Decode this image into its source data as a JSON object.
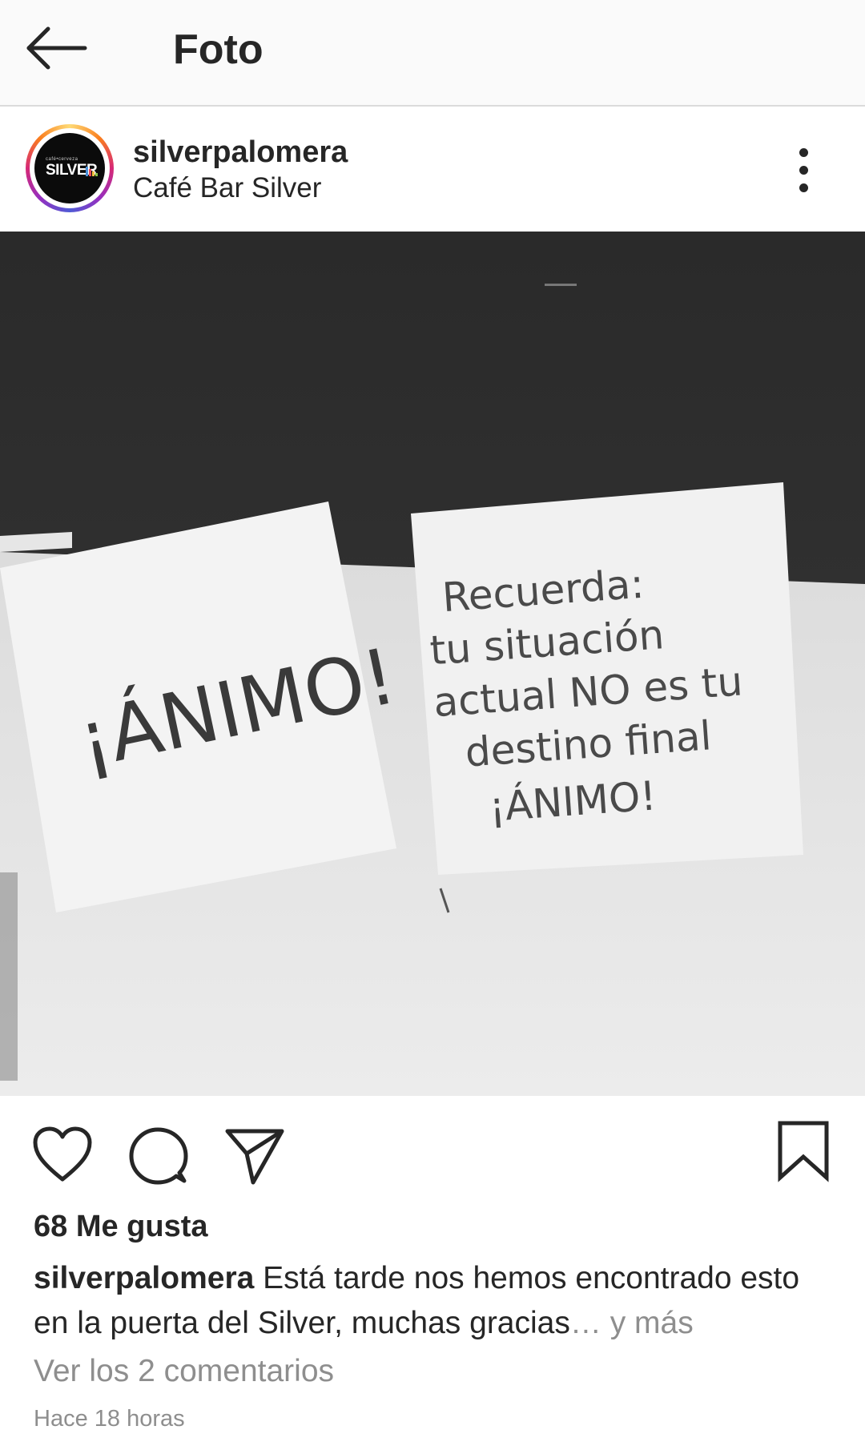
{
  "topbar": {
    "title": "Foto"
  },
  "post": {
    "username": "silverpalomera",
    "location": "Café Bar Silver",
    "avatar_label": "SILVER",
    "avatar_small_label": "café•cerveza",
    "photo": {
      "left_note": "¡ÁNIMO!",
      "right_note_lines": [
        "Recuerda:",
        "tu situación",
        "actual NO es tu",
        "destino final",
        "¡ÁNIMO!"
      ]
    },
    "likes": "68 Me gusta",
    "caption_user": "silverpalomera",
    "caption_text": "Está tarde nos hemos encontrado esto en la puerta del Silver, muchas gracias",
    "caption_ellipsis": "…",
    "caption_more": " y más",
    "comments_link": "Ver los 2 comentarios",
    "timestamp": "Hace 18 horas"
  },
  "icons": [
    "back-arrow-icon",
    "more-options-icon",
    "heart-icon",
    "comment-icon",
    "share-icon",
    "bookmark-icon"
  ]
}
